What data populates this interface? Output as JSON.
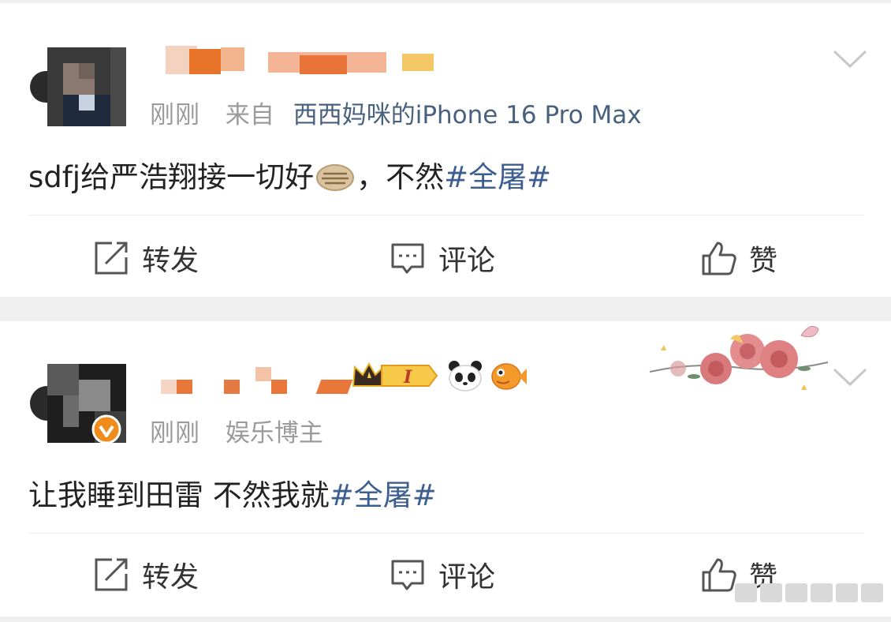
{
  "posts": [
    {
      "time": "刚刚",
      "from_prefix": "来自",
      "source": "西西妈咪的iPhone 16 Pro Max",
      "text_before": "sdfj给严浩翔接一切好",
      "text_after": "，不然",
      "hashtag": "#全屠#",
      "actions": {
        "repost": "转发",
        "comment": "评论",
        "like": "赞"
      }
    },
    {
      "time": "刚刚",
      "role": "娱乐博主",
      "text_before": "让我睡到田雷 不然我就",
      "hashtag": "#全屠#",
      "actions": {
        "repost": "转发",
        "comment": "评论",
        "like": "赞"
      }
    }
  ],
  "badges": {
    "level_label": "I"
  },
  "colors": {
    "link": "#48617e",
    "hashtag": "#3d5f8f",
    "meta": "#9b9b9b",
    "background": "#efefef",
    "verified": "#f08c1c"
  },
  "icons": [
    "repost-icon",
    "comment-icon",
    "like-icon",
    "chevron-down-icon",
    "crown-icon",
    "panda-icon",
    "fish-icon",
    "verified-icon",
    "emoji-icon"
  ]
}
